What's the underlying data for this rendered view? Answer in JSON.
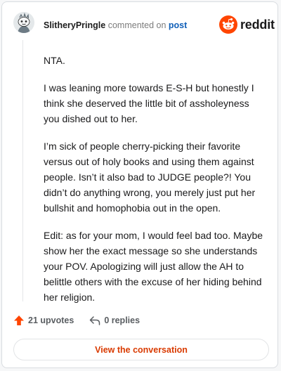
{
  "comment": {
    "username": "SlitheryPringle",
    "verb": "commented on",
    "post_link": "post",
    "paragraphs": [
      "NTA.",
      "I was leaning more towards E-S-H but honestly I think she deserved the little bit of assholeyness you dished out to her.",
      "I’m sick of people cherry-picking their favorite versus out of holy books and using them against people. Isn’t it also bad to JUDGE people?! You didn’t do anything wrong, you merely just put her bullshit and homophobia out in the open.",
      "Edit: as for your mom, I would feel bad too. Maybe show her the exact message so she understands your POV. Apologizing will just allow the AH to belittle others with the excuse of her hiding behind her religion."
    ],
    "upvotes_label": "21 upvotes",
    "replies_label": "0 replies"
  },
  "brand": {
    "name": "reddit",
    "color": "#ff4500"
  },
  "actions": {
    "view_conversation": "View the conversation"
  },
  "icons": {
    "avatar": "snoo-avatar-icon",
    "logo": "reddit-logo-icon",
    "upvote": "upvote-arrow-icon",
    "reply": "reply-arrow-icon"
  }
}
